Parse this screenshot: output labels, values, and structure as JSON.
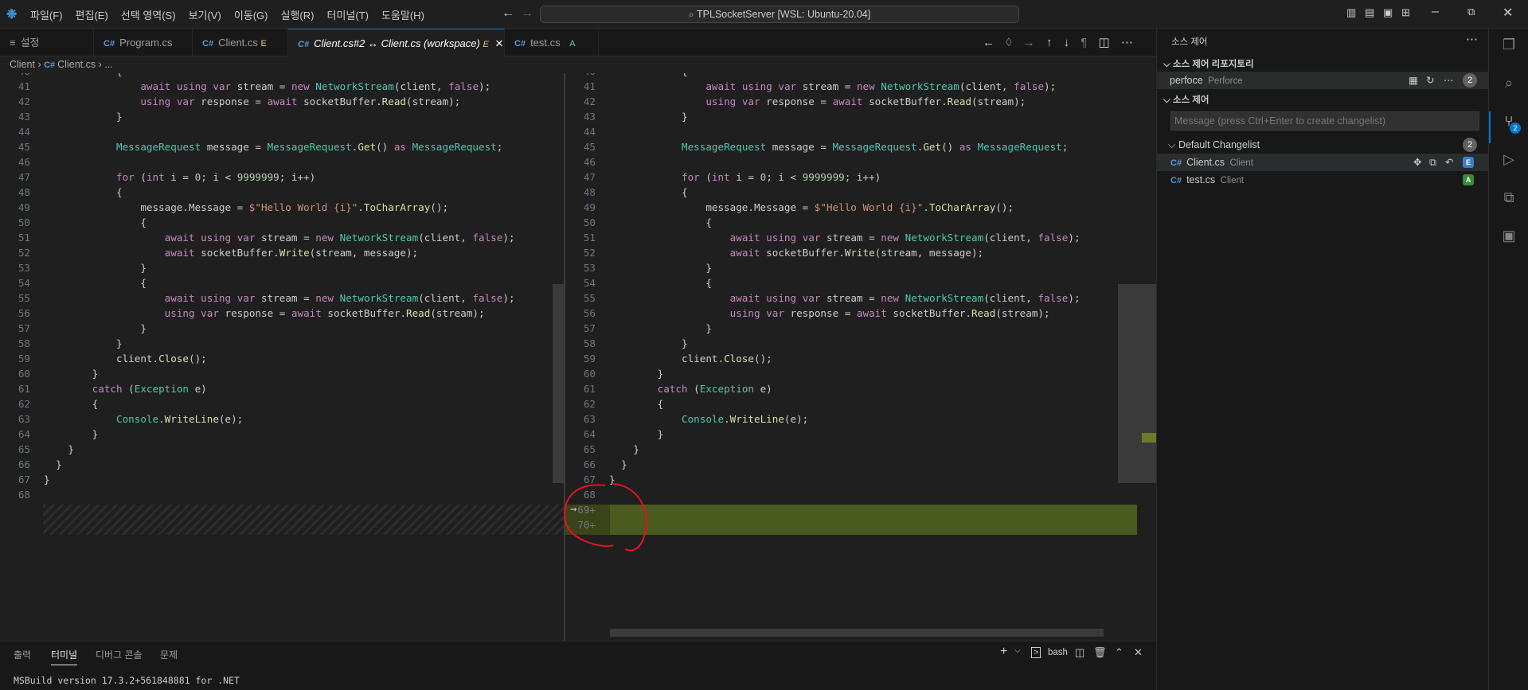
{
  "title_bar": {
    "menus": [
      "파일(F)",
      "편집(E)",
      "선택 영역(S)",
      "보기(V)",
      "이동(G)",
      "실행(R)",
      "터미널(T)",
      "도움말(H)"
    ],
    "command_center": "TPLSocketServer [WSL: Ubuntu-20.04]"
  },
  "tabs": [
    {
      "label": "설정",
      "badge": ""
    },
    {
      "label": "Program.cs",
      "badge": ""
    },
    {
      "label": "Client.cs",
      "badge": "E"
    },
    {
      "label": "Client.cs#2 ↔ Client.cs (workspace)",
      "badge": "E"
    },
    {
      "label": "test.cs",
      "badge": "A"
    }
  ],
  "breadcrumb": [
    "Client",
    "Client.cs",
    "..."
  ],
  "left_code": [
    {
      "n": "40",
      "t": "            {"
    },
    {
      "n": "41",
      "t": "                await using var stream = new NetworkStream(client, false);"
    },
    {
      "n": "42",
      "t": "                using var response = await socketBuffer.Read(stream);"
    },
    {
      "n": "43",
      "t": "            }"
    },
    {
      "n": "44",
      "t": ""
    },
    {
      "n": "45",
      "t": "            MessageRequest message = MessageRequest.Get() as MessageRequest;"
    },
    {
      "n": "46",
      "t": ""
    },
    {
      "n": "47",
      "t": "            for (int i = 0; i < 9999999; i++)"
    },
    {
      "n": "48",
      "t": "            {"
    },
    {
      "n": "49",
      "t": "                message.Message = $\"Hello World {i}\".ToCharArray();"
    },
    {
      "n": "50",
      "t": "                {"
    },
    {
      "n": "51",
      "t": "                    await using var stream = new NetworkStream(client, false);"
    },
    {
      "n": "52",
      "t": "                    await socketBuffer.Write(stream, message);"
    },
    {
      "n": "53",
      "t": "                }"
    },
    {
      "n": "54",
      "t": "                {"
    },
    {
      "n": "55",
      "t": "                    await using var stream = new NetworkStream(client, false);"
    },
    {
      "n": "56",
      "t": "                    using var response = await socketBuffer.Read(stream);"
    },
    {
      "n": "57",
      "t": "                }"
    },
    {
      "n": "58",
      "t": "            }"
    },
    {
      "n": "59",
      "t": "            client.Close();"
    },
    {
      "n": "60",
      "t": "        }"
    },
    {
      "n": "61",
      "t": "        catch (Exception e)"
    },
    {
      "n": "62",
      "t": "        {"
    },
    {
      "n": "63",
      "t": "            Console.WriteLine(e);"
    },
    {
      "n": "64",
      "t": "        }"
    },
    {
      "n": "65",
      "t": "    }"
    },
    {
      "n": "66",
      "t": "  }"
    },
    {
      "n": "67",
      "t": "}"
    },
    {
      "n": "68",
      "t": ""
    }
  ],
  "right_code": [
    {
      "n": "40",
      "t": "            {"
    },
    {
      "n": "41",
      "t": "                await using var stream = new NetworkStream(client, false);"
    },
    {
      "n": "42",
      "t": "                using var response = await socketBuffer.Read(stream);"
    },
    {
      "n": "43",
      "t": "            }"
    },
    {
      "n": "44",
      "t": ""
    },
    {
      "n": "45",
      "t": "            MessageRequest message = MessageRequest.Get() as MessageRequest;"
    },
    {
      "n": "46",
      "t": ""
    },
    {
      "n": "47",
      "t": "            for (int i = 0; i < 9999999; i++)"
    },
    {
      "n": "48",
      "t": "            {"
    },
    {
      "n": "49",
      "t": "                message.Message = $\"Hello World {i}\".ToCharArray();"
    },
    {
      "n": "50",
      "t": "                {"
    },
    {
      "n": "51",
      "t": "                    await using var stream = new NetworkStream(client, false);"
    },
    {
      "n": "52",
      "t": "                    await socketBuffer.Write(stream, message);"
    },
    {
      "n": "53",
      "t": "                }"
    },
    {
      "n": "54",
      "t": "                {"
    },
    {
      "n": "55",
      "t": "                    await using var stream = new NetworkStream(client, false);"
    },
    {
      "n": "56",
      "t": "                    using var response = await socketBuffer.Read(stream);"
    },
    {
      "n": "57",
      "t": "                }"
    },
    {
      "n": "58",
      "t": "            }"
    },
    {
      "n": "59",
      "t": "            client.Close();"
    },
    {
      "n": "60",
      "t": "        }"
    },
    {
      "n": "61",
      "t": "        catch (Exception e)"
    },
    {
      "n": "62",
      "t": "        {"
    },
    {
      "n": "63",
      "t": "            Console.WriteLine(e);"
    },
    {
      "n": "64",
      "t": "        }"
    },
    {
      "n": "65",
      "t": "    }"
    },
    {
      "n": "66",
      "t": "  }"
    },
    {
      "n": "67",
      "t": "}"
    },
    {
      "n": "68",
      "t": ""
    },
    {
      "n": "69+",
      "t": ""
    },
    {
      "n": "70+",
      "t": ""
    }
  ],
  "sidebar": {
    "header": "소스 제어",
    "section1": "소스 제어 리포지토리",
    "repo_name": "perfoce",
    "repo_provider": "Perforce",
    "repo_count": "2",
    "section2": "소스 제어",
    "message_placeholder": "Message (press Ctrl+Enter to create changelist)",
    "changelist": "Default Changelist",
    "changelist_count": "2",
    "files": [
      {
        "name": "Client.cs",
        "desc": "Client",
        "status": "E"
      },
      {
        "name": "test.cs",
        "desc": "Client",
        "status": "A"
      }
    ]
  },
  "activity": {
    "scm_badge": "2"
  },
  "panel": {
    "tabs": [
      "출력",
      "터미널",
      "디버그 콘솔",
      "문제"
    ],
    "terminal_name": "bash",
    "terminal_line": "MSBuild version 17.3.2+561848881 for .NET"
  },
  "colors": {
    "added": "#4b5a1e",
    "accent": "#0078d4",
    "keyword": "#c586c0",
    "type": "#4ec9b0",
    "string": "#ce9178",
    "method": "#dcdcaa"
  }
}
